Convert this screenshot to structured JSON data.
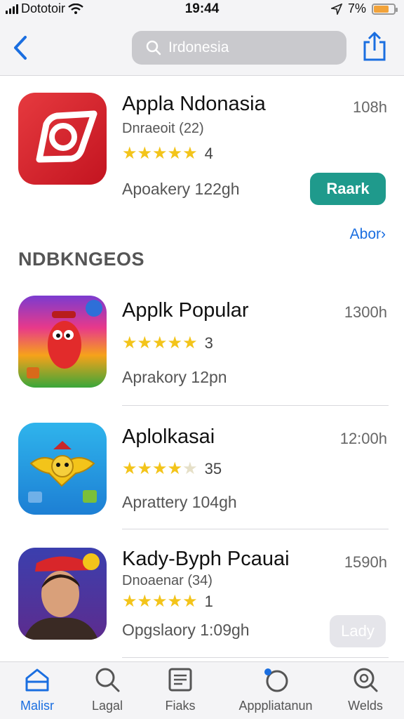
{
  "status_bar": {
    "carrier": "Dototoir",
    "time": "19:44",
    "battery_percent": "7%",
    "battery_level": 0.75
  },
  "nav": {
    "search_value": "Irdonesia",
    "search_icon": "search-icon",
    "back_icon": "chevron-left-icon",
    "share_icon": "share-icon"
  },
  "featured": {
    "name": "Appla Ndonasia",
    "subtitle": "Dnraeoit (22)",
    "time": "108h",
    "stars": 5,
    "rating_count": "4",
    "meta": "Apoakery 122gh",
    "button": "Raark"
  },
  "see_all": "Abor›",
  "section_title": "NDBKNGEOS",
  "apps": [
    {
      "name": "Applk Popular",
      "time": "1300h",
      "stars": 5,
      "rating_count": "3",
      "meta": "Aprakory 12pn"
    },
    {
      "name": "Aplolkasai",
      "time": "12:00h",
      "stars": 4,
      "rating_count": "35",
      "meta": "Aprattery 104gh"
    },
    {
      "name": "Kady-Byph Pcauai",
      "subtitle": "Dnoaenar (34)",
      "time": "1590h",
      "stars": 5,
      "rating_count": "1",
      "meta": "Opgslaory 1:09gh",
      "button": "Lady"
    }
  ],
  "tabs": [
    {
      "label": "Malisr",
      "icon": "house-icon",
      "active": true
    },
    {
      "label": "Lagal",
      "icon": "search-icon",
      "active": false
    },
    {
      "label": "Fiaks",
      "icon": "list-icon",
      "active": false
    },
    {
      "label": "Apppliatanun",
      "icon": "apps-icon",
      "active": false
    },
    {
      "label": "Welds",
      "icon": "search-icon",
      "active": false
    }
  ],
  "colors": {
    "accent": "#1a6ee0",
    "install": "#1f9a8c",
    "star": "#f3c41a"
  }
}
